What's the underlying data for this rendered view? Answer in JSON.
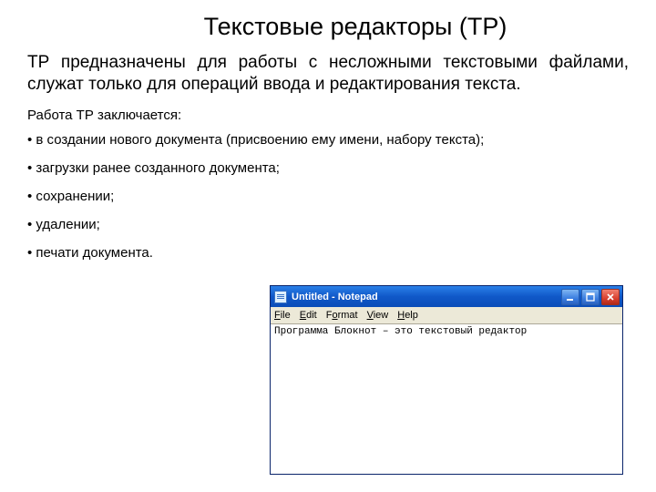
{
  "title": "Текстовые редакторы (ТР)",
  "lead": "ТР предназначены для работы с несложными текстовыми файлами, служат только для операций ввода и редактирования текста.",
  "subhead": "Работа ТР заключается:",
  "bullets": [
    "в создании нового документа (присвоению ему имени, набору текста);",
    "загрузки ранее созданного документа;",
    "сохранении;",
    "удалении;",
    "печати документа."
  ],
  "notepad": {
    "title": "Untitled - Notepad",
    "menu": {
      "file": "File",
      "edit": "Edit",
      "format": "Format",
      "view": "View",
      "help": "Help"
    },
    "content": "Программа Блокнот – это текстовый редактор"
  }
}
